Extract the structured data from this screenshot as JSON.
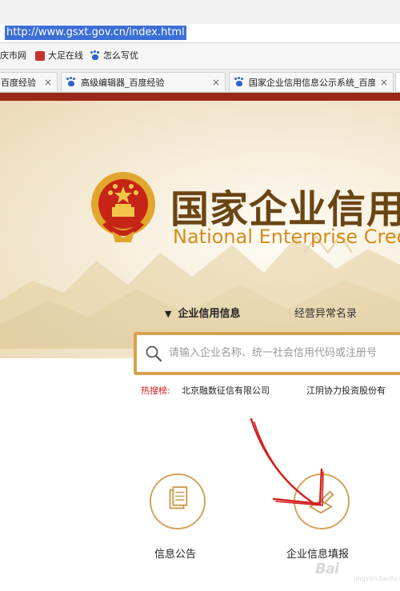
{
  "browser": {
    "url": "http://www.gsxt.gov.cn/index.html",
    "bookmarks": [
      {
        "label": "庆市网"
      },
      {
        "label": "大足在线"
      },
      {
        "label": "怎么写优"
      }
    ],
    "tabs": [
      {
        "label": "百度经验",
        "close": "×"
      },
      {
        "label": "高级编辑器_百度经验",
        "close": "×"
      },
      {
        "label": "国家企业信用信息公示系统_百度",
        "close": "×"
      }
    ]
  },
  "site": {
    "title_cn": "国家企业信用",
    "title_en": "National Enterprise Cred",
    "nav": {
      "selected": "企业信用信息",
      "other": "经营异常名录"
    },
    "search": {
      "placeholder": "请输入企业名称、统一社会信用代码或注册号"
    },
    "hot": {
      "label": "热搜榜:",
      "items": [
        "北京融数征信有限公司",
        "江阴协力投资股份有"
      ]
    },
    "services": [
      {
        "label": "信息公告",
        "icon": "document-icon"
      },
      {
        "label": "企业信息填报",
        "icon": "edit-icon"
      }
    ]
  },
  "watermark": {
    "text": "Bai",
    "sub": "jingyan.baidu.com"
  },
  "colors": {
    "brand_gold": "#d1a459",
    "title_brown": "#6a4514",
    "title_orange": "#d48c1b",
    "annotation_red": "#d42020",
    "url_highlight": "#3b6fd6"
  }
}
